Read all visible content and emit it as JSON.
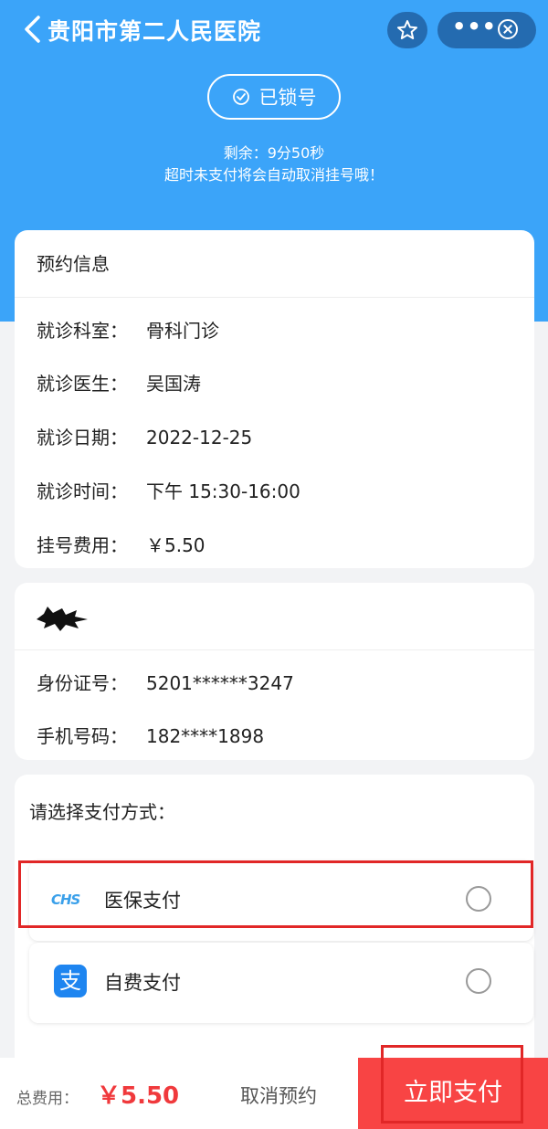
{
  "header": {
    "title": "贵阳市第二人民医院",
    "more_label": "•••",
    "lock_status": "已锁号",
    "remaining": "剩余：9分50秒",
    "timeout_notice": "超时未支付将会自动取消挂号哦！",
    "brand_color": "#3ba4f9"
  },
  "appointment": {
    "section_title": "预约信息",
    "rows": [
      {
        "label": "就诊科室：",
        "value": "骨科门诊"
      },
      {
        "label": "就诊医生：",
        "value": "吴国涛"
      },
      {
        "label": "就诊日期：",
        "value": "2022-12-25"
      },
      {
        "label": "就诊时间：",
        "value": "下午 15:30-16:00"
      },
      {
        "label": "挂号费用：",
        "value": "￥5.50"
      }
    ]
  },
  "patient": {
    "rows": [
      {
        "label": "身份证号：",
        "value": "5201******3247"
      },
      {
        "label": "手机号码：",
        "value": "182****1898"
      }
    ]
  },
  "payment": {
    "title": "请选择支付方式：",
    "options": [
      {
        "label": "医保支付",
        "icon": "chs-logo-icon",
        "logo_text": "CHS",
        "selected": false
      },
      {
        "label": "自费支付",
        "icon": "alipay-icon",
        "logo_text": "支",
        "selected": false
      }
    ]
  },
  "footer": {
    "total_label": "总费用：",
    "total_value": "￥5.50",
    "cancel_label": "取消预约",
    "pay_label": "立即支付",
    "accent_color": "#f0393c"
  }
}
